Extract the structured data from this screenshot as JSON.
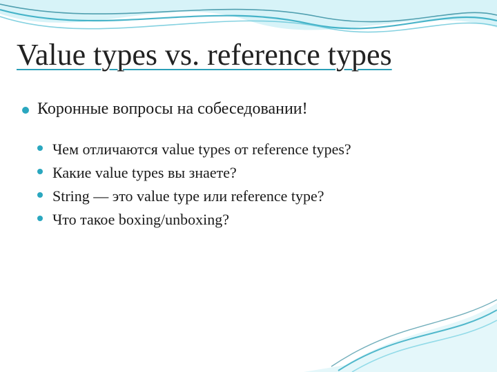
{
  "title": "Value types vs. reference types",
  "bullet1": "Коронные вопросы на собеседовании!",
  "subbullets": {
    "0": "Чем отличаются value types от reference types?",
    "1": "Какие value types вы знаете?",
    "2": "String — это value type или reference type?",
    "3": "Что такое boxing/unboxing?"
  },
  "colors": {
    "accent": "#2aa7bf",
    "wave_dark": "#1e7f99",
    "wave_light": "#a7e3ee"
  }
}
